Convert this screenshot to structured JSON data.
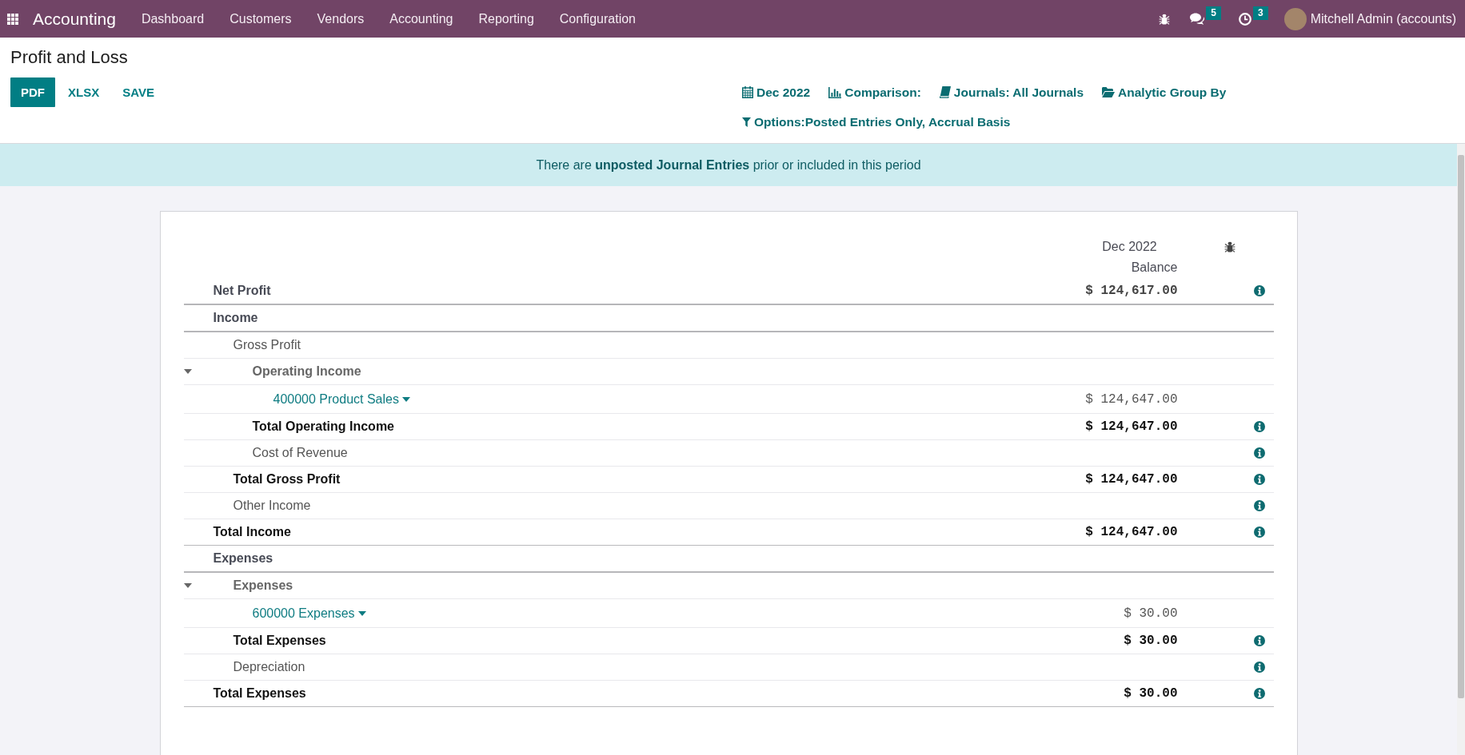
{
  "navbar": {
    "brand": "Accounting",
    "menu": [
      "Dashboard",
      "Customers",
      "Vendors",
      "Accounting",
      "Reporting",
      "Configuration"
    ],
    "systray": [
      {
        "kind": "debug"
      },
      {
        "kind": "messages",
        "count": "5"
      },
      {
        "kind": "activities",
        "count": "3"
      }
    ],
    "user": "Mitchell Admin (accounts)"
  },
  "control_panel": {
    "title": "Profit and Loss",
    "buttons": [
      {
        "label": "PDF",
        "primary": true
      },
      {
        "label": "XLSX",
        "primary": false
      },
      {
        "label": "SAVE",
        "primary": false
      }
    ],
    "filters": [
      {
        "kind": "date",
        "label": "Dec 2022"
      },
      {
        "kind": "comparison",
        "label": "Comparison:"
      },
      {
        "kind": "journals",
        "label": "Journals: All Journals"
      },
      {
        "kind": "analytic",
        "label": "Analytic Group By"
      },
      {
        "kind": "options",
        "label": "Options:Posted Entries Only, Accrual Basis"
      }
    ]
  },
  "alert": {
    "message": "There are **unposted Journal Entries** prior or included in this period"
  },
  "report": {
    "columns": [
      {
        "period": "Dec 2022",
        "label": "Balance"
      }
    ],
    "lines": [
      {
        "kind": "title",
        "name": "Net Profit",
        "amount": "$ 124,617.00",
        "info": true
      },
      {
        "kind": "title",
        "name": "Income",
        "info": false,
        "children": [
          {
            "kind": "line",
            "name": "Gross Profit",
            "info": false,
            "children": [
              {
                "kind": "foldable",
                "name": "Operating Income",
                "expanded": true,
                "info": false,
                "children": [
                  {
                    "kind": "account",
                    "name": "400000 Product Sales",
                    "amount": "$ 124,647.00",
                    "info": false
                  }
                ]
              },
              {
                "kind": "total",
                "name": "Total Operating Income",
                "amount": "$ 124,647.00",
                "info": true
              },
              {
                "kind": "line",
                "name": "Cost of Revenue",
                "info": true
              }
            ]
          },
          {
            "kind": "total",
            "name": "Total Gross Profit",
            "amount": "$ 124,647.00",
            "info": true
          },
          {
            "kind": "line",
            "name": "Other Income",
            "info": true
          }
        ]
      },
      {
        "kind": "total",
        "name": "Total Income",
        "amount": "$ 124,647.00",
        "info": true
      },
      {
        "kind": "title",
        "name": "Expenses",
        "info": false,
        "children": [
          {
            "kind": "foldable",
            "name": "Expenses",
            "expanded": true,
            "info": false,
            "children": [
              {
                "kind": "account",
                "name": "600000 Expenses",
                "amount": "$ 30.00",
                "info": false
              }
            ]
          },
          {
            "kind": "total",
            "name": "Total Expenses",
            "amount": "$ 30.00",
            "info": true
          },
          {
            "kind": "line",
            "name": "Depreciation",
            "info": true
          }
        ]
      },
      {
        "kind": "total",
        "name": "Total Expenses",
        "amount": "$ 30.00",
        "info": true
      }
    ]
  }
}
